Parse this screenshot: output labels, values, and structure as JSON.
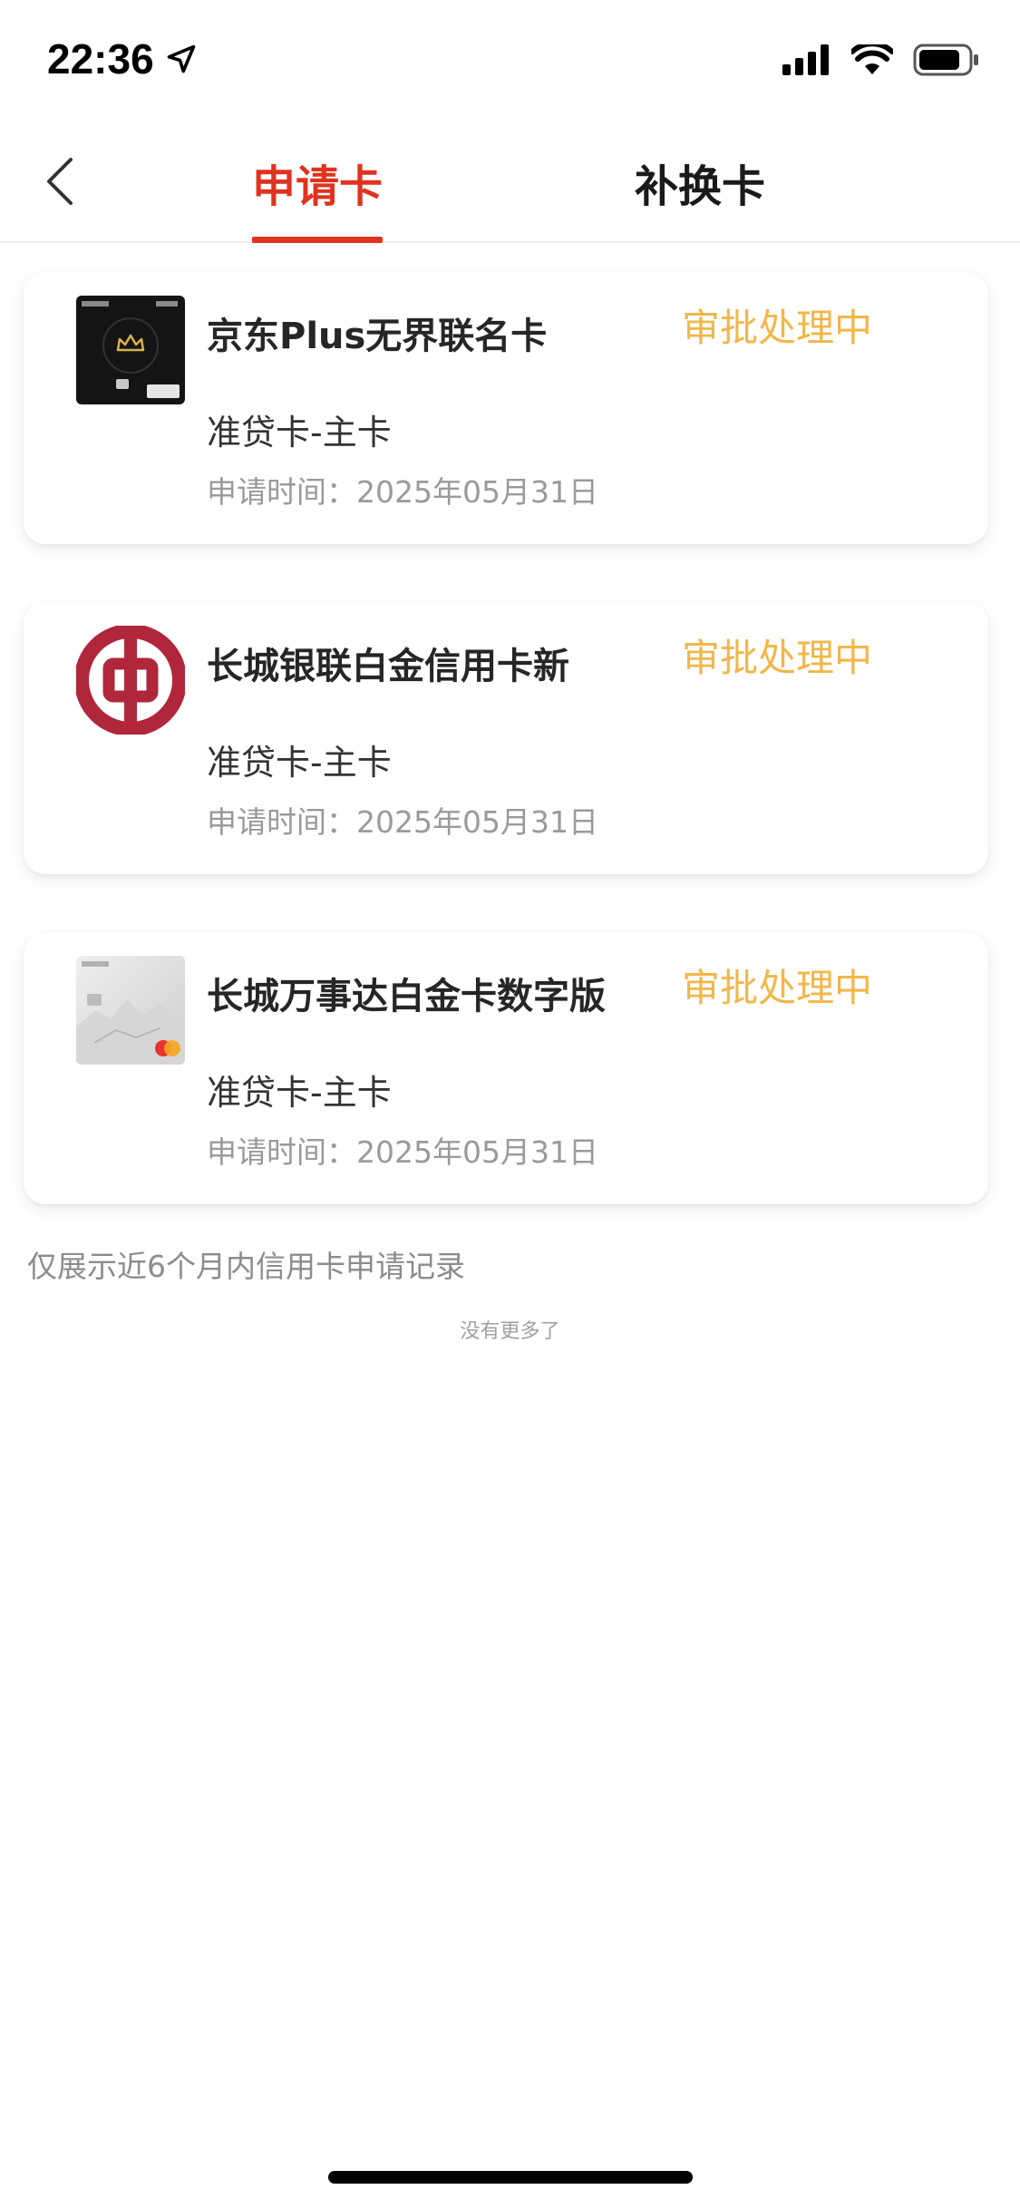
{
  "status_bar": {
    "time": "22:36"
  },
  "nav": {
    "tabs": [
      {
        "label": "申请卡",
        "active": true
      },
      {
        "label": "补换卡",
        "active": false
      }
    ]
  },
  "colors": {
    "accent": "#e0331f",
    "status": "#f1b74a",
    "muted": "#9a9a9a"
  },
  "cards": [
    {
      "name": "京东Plus无界联名卡",
      "status": "审批处理中",
      "type": "准贷卡-主卡",
      "date": "申请时间：2025年05月31日",
      "thumb_icon": "black-card-image"
    },
    {
      "name": "长城银联白金信用卡新",
      "status": "审批处理中",
      "type": "准贷卡-主卡",
      "date": "申请时间：2025年05月31日",
      "thumb_icon": "bank-of-china-logo"
    },
    {
      "name": "长城万事达白金卡数字版",
      "status": "审批处理中",
      "type": "准贷卡-主卡",
      "date": "申请时间：2025年05月31日",
      "thumb_icon": "silver-card-image"
    }
  ],
  "notice": "仅展示近6个月内信用卡申请记录",
  "no_more": "没有更多了"
}
